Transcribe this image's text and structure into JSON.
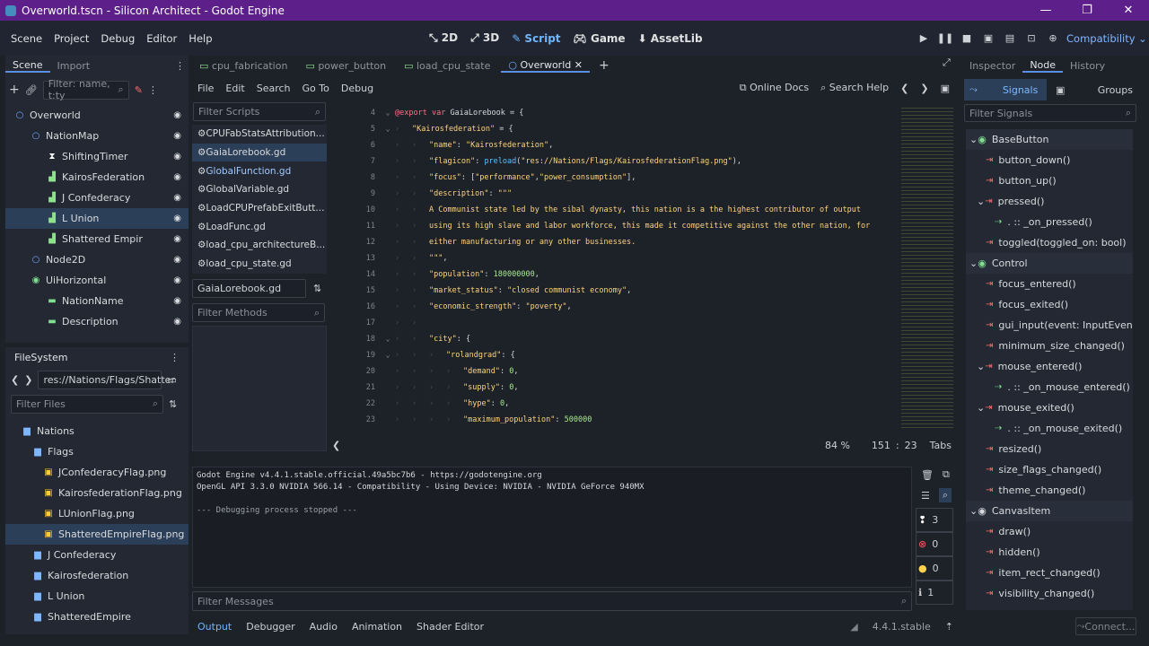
{
  "window": {
    "title": "Overworld.tscn - Silicon Architect - Godot Engine",
    "min": "—",
    "max": "❐",
    "close": "✕"
  },
  "menu": [
    "Scene",
    "Project",
    "Debug",
    "Editor",
    "Help"
  ],
  "modes": [
    "2D",
    "3D",
    "Script",
    "Game",
    "AssetLib"
  ],
  "renderer": "Compatibility",
  "scene_tabs": [
    "Scene",
    "Import"
  ],
  "scene_filter_placeholder": "Filter: name, t:ty",
  "scene_tree": [
    {
      "label": "Overworld",
      "icon": "node2d-icon",
      "depth": 0
    },
    {
      "label": "NationMap",
      "icon": "node2d-icon",
      "depth": 1
    },
    {
      "label": "ShiftingTimer",
      "icon": "timer-icon",
      "depth": 2
    },
    {
      "label": "KairosFederation",
      "icon": "area-icon",
      "depth": 2
    },
    {
      "label": "J Confederacy",
      "icon": "area-icon",
      "depth": 2
    },
    {
      "label": "L Union",
      "icon": "area-icon",
      "depth": 2,
      "selected": true
    },
    {
      "label": "Shattered Empir",
      "icon": "area-icon",
      "depth": 2
    },
    {
      "label": "Node2D",
      "icon": "node2d-icon",
      "depth": 1
    },
    {
      "label": "UiHorizontal",
      "icon": "control-icon",
      "depth": 1
    },
    {
      "label": "NationName",
      "icon": "label-icon",
      "depth": 2
    },
    {
      "label": "Description",
      "icon": "label-icon",
      "depth": 2
    }
  ],
  "filesystem": {
    "title": "FileSystem",
    "path": "res://Nations/Flags/Shatter",
    "filter_placeholder": "Filter Files",
    "items": [
      {
        "label": "Nations",
        "type": "folder",
        "depth": 1
      },
      {
        "label": "Flags",
        "type": "folder",
        "depth": 2
      },
      {
        "label": "JConfederacyFlag.png",
        "type": "file",
        "depth": 3
      },
      {
        "label": "KairosfederationFlag.png",
        "type": "file",
        "depth": 3
      },
      {
        "label": "LUnionFlag.png",
        "type": "file",
        "depth": 3
      },
      {
        "label": "ShatteredEmpireFlag.png",
        "type": "file",
        "depth": 3,
        "selected": true
      },
      {
        "label": "J Confederacy",
        "type": "folder",
        "depth": 2
      },
      {
        "label": "Kairosfederation",
        "type": "folder",
        "depth": 2
      },
      {
        "label": "L Union",
        "type": "folder",
        "depth": 2
      },
      {
        "label": "ShatteredEmpire",
        "type": "folder",
        "depth": 2
      }
    ]
  },
  "script_tabs": [
    {
      "label": "cpu_fabrication",
      "active": false
    },
    {
      "label": "power_button",
      "active": false
    },
    {
      "label": "load_cpu_state",
      "active": false
    },
    {
      "label": "Overworld",
      "active": true
    }
  ],
  "script_menu": [
    "File",
    "Edit",
    "Search",
    "Go To",
    "Debug"
  ],
  "online_docs": "Online Docs",
  "search_help": "Search Help",
  "filter_scripts_placeholder": "Filter Scripts",
  "script_list": [
    {
      "label": "CPUFabStatsAttribution...",
      "selected": false
    },
    {
      "label": "GaiaLorebook.gd",
      "selected": true
    },
    {
      "label": "GlobalFunction.gd",
      "selected": false,
      "hl": true
    },
    {
      "label": "GlobalVariable.gd",
      "selected": false
    },
    {
      "label": "LoadCPUPrefabExitButt...",
      "selected": false
    },
    {
      "label": "LoadFunc.gd",
      "selected": false
    },
    {
      "label": "load_cpu_architectureB...",
      "selected": false
    },
    {
      "label": "load_cpu_state.gd",
      "selected": false
    }
  ],
  "current_script": "GaiaLorebook.gd",
  "filter_methods_placeholder": "Filter Methods",
  "code_lines": [
    {
      "n": "4",
      "fold": "⌄",
      "ind": 0,
      "html": "<span class='kw'>@export</span> <span class='kw'>var</span> <span class='def'>GaiaLorebook = {</span>"
    },
    {
      "n": "5",
      "fold": "⌄",
      "ind": 1,
      "html": "<span class='str'>\"Kairosfederation\"</span><span class='def'> = {</span>"
    },
    {
      "n": "6",
      "fold": "",
      "ind": 2,
      "html": "<span class='str'>\"name\"</span><span class='def'>: </span><span class='str'>\"Kairosfederation\"</span><span class='def'>,</span>"
    },
    {
      "n": "7",
      "fold": "",
      "ind": 2,
      "html": "<span class='str'>\"flagicon\"</span><span class='def'>: </span><span class='fn'>preload</span><span class='def'>(</span><span class='str'>\"res://Nations/Flags/KairosfederationFlag.png\"</span><span class='def'>),</span>"
    },
    {
      "n": "8",
      "fold": "",
      "ind": 2,
      "html": "<span class='str'>\"focus\"</span><span class='def'>: [</span><span class='str'>\"performance\"</span><span class='def'>,</span><span class='str'>\"power_consumption\"</span><span class='def'>],</span>"
    },
    {
      "n": "9",
      "fold": "",
      "ind": 2,
      "html": "<span class='str'>\"description\"</span><span class='def'>: </span><span class='str'>\"\"\"</span>"
    },
    {
      "n": "10",
      "fold": "",
      "ind": 2,
      "html": "<span class='str'>A Communist state led by the sibal dynasty, this nation is a the highest contributor of output</span>"
    },
    {
      "n": "11",
      "fold": "",
      "ind": 2,
      "html": "<span class='str'>using its high slave and labor workforce, this made it competitive against the other nation, for</span>"
    },
    {
      "n": "12",
      "fold": "",
      "ind": 2,
      "html": "<span class='str'>either manufacturing or any other businesses.</span>"
    },
    {
      "n": "13",
      "fold": "",
      "ind": 2,
      "html": "<span class='str'>\"\"\"</span><span class='def'>,</span>"
    },
    {
      "n": "14",
      "fold": "",
      "ind": 2,
      "html": "<span class='str'>\"population\"</span><span class='def'>: </span><span class='num'>180000000</span><span class='def'>,</span>"
    },
    {
      "n": "15",
      "fold": "",
      "ind": 2,
      "html": "<span class='str'>\"market_status\"</span><span class='def'>: </span><span class='str'>\"closed communist economy\"</span><span class='def'>,</span>"
    },
    {
      "n": "16",
      "fold": "",
      "ind": 2,
      "html": "<span class='str'>\"economic_strength\"</span><span class='def'>: </span><span class='str'>\"poverty\"</span><span class='def'>,</span>"
    },
    {
      "n": "17",
      "fold": "",
      "ind": 2,
      "html": ""
    },
    {
      "n": "18",
      "fold": "⌄",
      "ind": 2,
      "html": "<span class='str'>\"city\"</span><span class='def'>: {</span>"
    },
    {
      "n": "19",
      "fold": "⌄",
      "ind": 3,
      "html": "<span class='str'>\"rolandgrad\"</span><span class='def'>: {</span>"
    },
    {
      "n": "20",
      "fold": "",
      "ind": 4,
      "html": "<span class='str'>\"demand\"</span><span class='def'>: </span><span class='num'>0</span><span class='def'>,</span>"
    },
    {
      "n": "21",
      "fold": "",
      "ind": 4,
      "html": "<span class='str'>\"supply\"</span><span class='def'>: </span><span class='num'>0</span><span class='def'>,</span>"
    },
    {
      "n": "22",
      "fold": "",
      "ind": 4,
      "html": "<span class='str'>\"hype\"</span><span class='def'>: </span><span class='num'>0</span><span class='def'>,</span>"
    },
    {
      "n": "23",
      "fold": "",
      "ind": 4,
      "html": "<span class='str'>\"maximum_population\"</span><span class='def'>: </span><span class='num'>500000</span>"
    }
  ],
  "status": {
    "zoom": "84 %",
    "line": "151",
    "sep": ":",
    "col": "23",
    "indent": "Tabs"
  },
  "output_lines": [
    "Godot Engine v4.4.1.stable.official.49a5bc7b6 - https://godotengine.org",
    "OpenGL API 3.3.0 NVIDIA 566.14 - Compatibility - Using Device: NVIDIA - NVIDIA GeForce 940MX",
    "",
    "--- Debugging process stopped ---"
  ],
  "filter_messages_placeholder": "Filter Messages",
  "counts": {
    "messages": "3",
    "errors": "0",
    "warnings": "0",
    "info": "1"
  },
  "bottom_tabs": [
    "Output",
    "Debugger",
    "Audio",
    "Animation",
    "Shader Editor"
  ],
  "version": "4.4.1.stable",
  "connect": "Connect...",
  "inspector_tabs": [
    "Inspector",
    "Node",
    "History"
  ],
  "signals_tab": "Signals",
  "groups_tab": "Groups",
  "filter_signals_placeholder": "Filter Signals",
  "signals": [
    {
      "label": "BaseButton",
      "kind": "class",
      "icon": "basebutton-icon"
    },
    {
      "label": "button_down()",
      "kind": "sig"
    },
    {
      "label": "button_up()",
      "kind": "sig"
    },
    {
      "label": "pressed()",
      "kind": "sig",
      "expanded": true
    },
    {
      "label": ". :: _on_pressed()",
      "kind": "conn"
    },
    {
      "label": "toggled(toggled_on: bool)",
      "kind": "sig"
    },
    {
      "label": "Control",
      "kind": "class",
      "icon": "control-icon"
    },
    {
      "label": "focus_entered()",
      "kind": "sig"
    },
    {
      "label": "focus_exited()",
      "kind": "sig"
    },
    {
      "label": "gui_input(event: InputEvent)",
      "kind": "sig"
    },
    {
      "label": "minimum_size_changed()",
      "kind": "sig"
    },
    {
      "label": "mouse_entered()",
      "kind": "sig",
      "expanded": true
    },
    {
      "label": ". :: _on_mouse_entered()",
      "kind": "conn"
    },
    {
      "label": "mouse_exited()",
      "kind": "sig",
      "expanded": true
    },
    {
      "label": ". :: _on_mouse_exited()",
      "kind": "conn"
    },
    {
      "label": "resized()",
      "kind": "sig"
    },
    {
      "label": "size_flags_changed()",
      "kind": "sig"
    },
    {
      "label": "theme_changed()",
      "kind": "sig"
    },
    {
      "label": "CanvasItem",
      "kind": "class",
      "icon": "canvasitem-icon"
    },
    {
      "label": "draw()",
      "kind": "sig"
    },
    {
      "label": "hidden()",
      "kind": "sig"
    },
    {
      "label": "item_rect_changed()",
      "kind": "sig"
    },
    {
      "label": "visibility_changed()",
      "kind": "sig"
    }
  ]
}
